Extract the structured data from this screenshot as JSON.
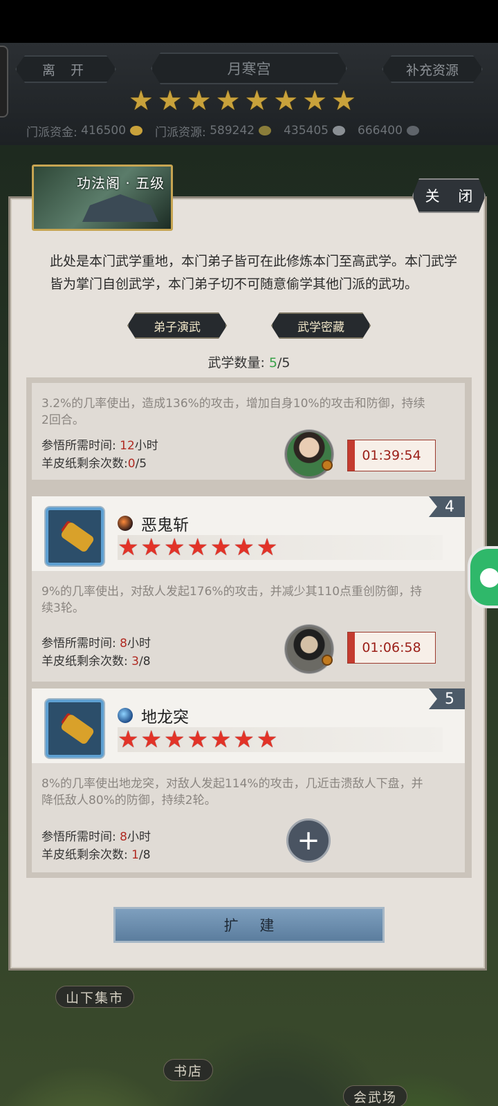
{
  "header": {
    "leave": "离 开",
    "title": "月寒宫",
    "refill": "补充资源",
    "stars": 8,
    "resources": [
      {
        "label": "门派资金:",
        "value": "416500",
        "icon": "coin-icon",
        "color": "#c9a23b"
      },
      {
        "label": "门派资源:",
        "value": "589242",
        "icon": "herb-icon",
        "color": "#8a7d3a"
      },
      {
        "label": "",
        "value": "435405",
        "icon": "sword-icon",
        "color": "#8a8f94"
      },
      {
        "label": "",
        "value": "666400",
        "icon": "ore-icon",
        "color": "#5f646a"
      }
    ]
  },
  "panel": {
    "badge_title": "功法阁 · 五级",
    "close": "关 闭",
    "description": "此处是本门武学重地，本门弟子皆可在此修炼本门至高武学。本门武学皆为掌门自创武学，本门弟子切不可随意偷学其他门派的武功。",
    "tab_disciples": "弟子演武",
    "tab_vault": "武学密藏",
    "count_label": "武学数量:",
    "count_current": "5",
    "count_total": "/5",
    "expand": "扩 建"
  },
  "skills": [
    {
      "effect": "3.2%的几率使出，造成136%的攻击，增加自身10%的攻击和防御，持续2回合。",
      "time_label": "参悟所需时间:",
      "time_value": "12",
      "time_unit": "小时",
      "scroll_label": "羊皮纸剩余次数:",
      "scroll_used": "0",
      "scroll_total": "/5",
      "timer": "01:39:54"
    },
    {
      "number": "4",
      "name": "恶鬼斩",
      "element": "fire",
      "stars": 7,
      "effect": "9%的几率使出，对敌人发起176%的攻击，并减少其110点重创防御，持续3轮。",
      "time_label": "参悟所需时间:",
      "time_value": "8",
      "time_unit": "小时",
      "scroll_label": "羊皮纸剩余次数:",
      "scroll_used": "3",
      "scroll_total": "/8",
      "timer": "01:06:58"
    },
    {
      "number": "5",
      "name": "地龙突",
      "element": "water",
      "stars": 7,
      "effect": "8%的几率使出地龙突，对敌人发起114%的攻击，几近击溃敌人下盘，并降低敌人80%的防御，持续2轮。",
      "time_label": "参悟所需时间:",
      "time_value": "8",
      "time_unit": "小时",
      "scroll_label": "羊皮纸剩余次数:",
      "scroll_used": "1",
      "scroll_total": "/8",
      "add": "+"
    }
  ],
  "map": {
    "market": "山下集市",
    "bookstore": "书店",
    "arena": "会武场"
  }
}
